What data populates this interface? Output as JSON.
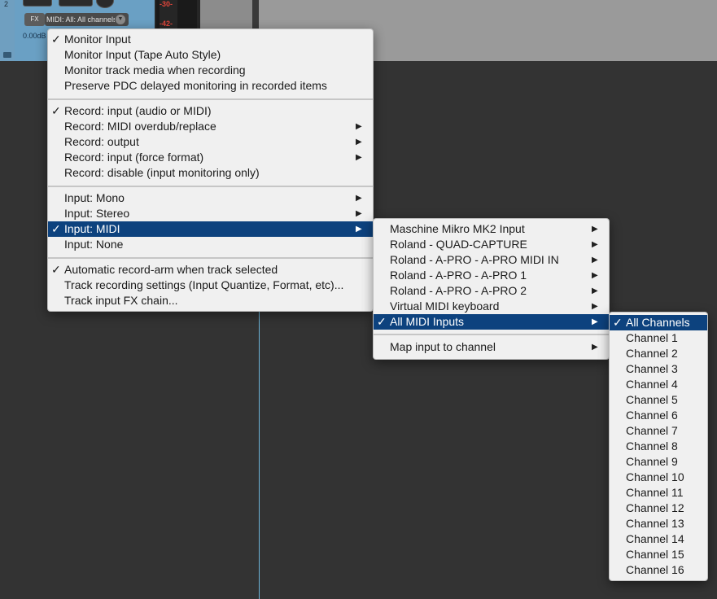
{
  "track": {
    "number": "2",
    "fx_label": "FX",
    "input_display": "MIDI: All: All channels",
    "volume": "0.00dB",
    "meter_scale": [
      "-30-",
      "-42-"
    ]
  },
  "icons": {
    "check": "✓",
    "submenu_arrow": "▶",
    "dropdown": "▼"
  },
  "colors": {
    "highlight": "#0d427e",
    "menu_bg": "#f0f0f0",
    "track_color": "#6aa0c4"
  },
  "menu_main": {
    "items": [
      {
        "label": "Monitor Input",
        "checked": true
      },
      {
        "label": "Monitor Input (Tape Auto Style)"
      },
      {
        "label": "Monitor track media when recording"
      },
      {
        "label": "Preserve PDC delayed monitoring in recorded items"
      },
      {
        "label": "Record: input (audio or MIDI)",
        "checked": true
      },
      {
        "label": "Record: MIDI overdub/replace",
        "submenu": true
      },
      {
        "label": "Record: output",
        "submenu": true
      },
      {
        "label": "Record: input (force format)",
        "submenu": true
      },
      {
        "label": "Record: disable (input monitoring only)"
      },
      {
        "label": "Input: Mono",
        "submenu": true
      },
      {
        "label": "Input: Stereo",
        "submenu": true
      },
      {
        "label": "Input: MIDI",
        "submenu": true,
        "checked": true,
        "selected": true
      },
      {
        "label": "Input: None"
      },
      {
        "label": "Automatic record-arm when track selected",
        "checked": true
      },
      {
        "label": "Track recording settings (Input Quantize, Format, etc)..."
      },
      {
        "label": "Track input FX chain..."
      }
    ]
  },
  "menu_midi": {
    "items": [
      {
        "label": "Maschine Mikro MK2 Input",
        "submenu": true
      },
      {
        "label": "Roland - QUAD-CAPTURE",
        "submenu": true
      },
      {
        "label": "Roland - A-PRO - A-PRO MIDI IN",
        "submenu": true
      },
      {
        "label": "Roland - A-PRO - A-PRO 1",
        "submenu": true
      },
      {
        "label": "Roland - A-PRO - A-PRO 2",
        "submenu": true
      },
      {
        "label": "Virtual MIDI keyboard",
        "submenu": true
      },
      {
        "label": "All MIDI Inputs",
        "submenu": true,
        "checked": true,
        "selected": true
      },
      {
        "label": "Map input to channel",
        "submenu": true
      }
    ]
  },
  "menu_channels": {
    "items": [
      {
        "label": "All Channels",
        "checked": true,
        "selected": true
      },
      {
        "label": "Channel 1"
      },
      {
        "label": "Channel 2"
      },
      {
        "label": "Channel 3"
      },
      {
        "label": "Channel 4"
      },
      {
        "label": "Channel 5"
      },
      {
        "label": "Channel 6"
      },
      {
        "label": "Channel 7"
      },
      {
        "label": "Channel 8"
      },
      {
        "label": "Channel 9"
      },
      {
        "label": "Channel 10"
      },
      {
        "label": "Channel 11"
      },
      {
        "label": "Channel 12"
      },
      {
        "label": "Channel 13"
      },
      {
        "label": "Channel 14"
      },
      {
        "label": "Channel 15"
      },
      {
        "label": "Channel 16"
      }
    ]
  }
}
